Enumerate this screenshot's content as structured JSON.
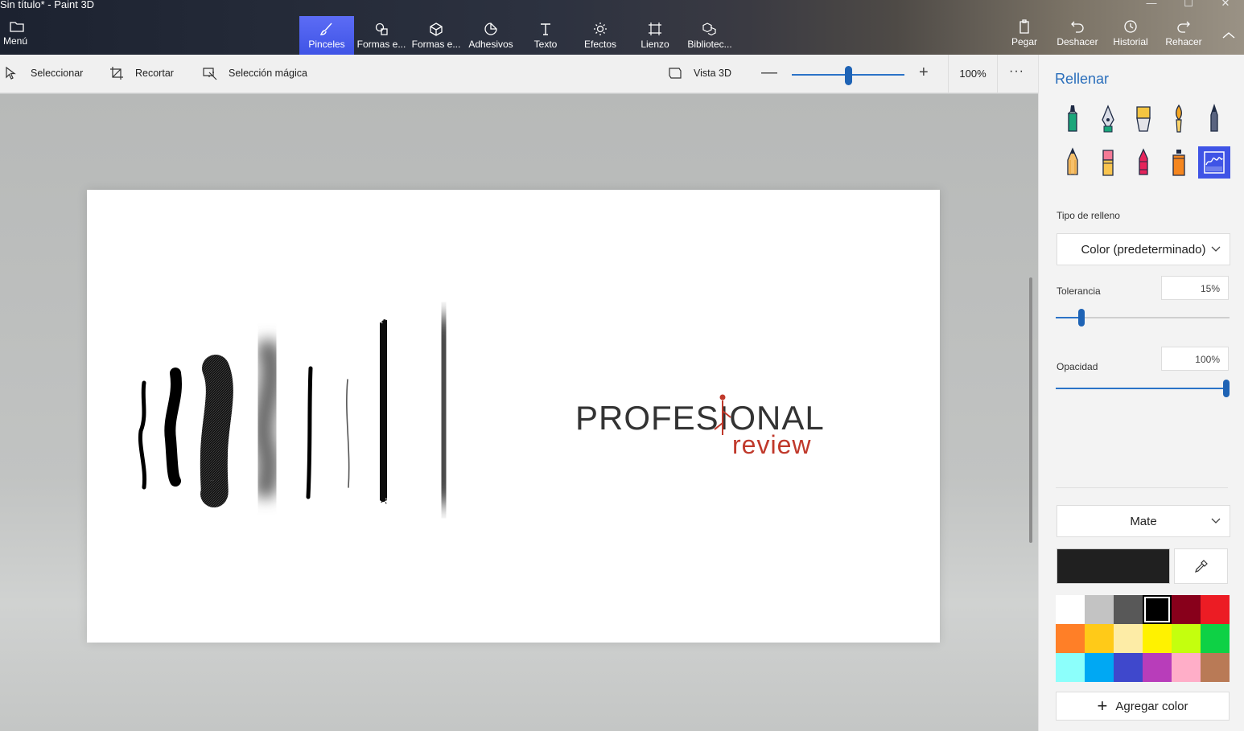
{
  "window": {
    "title": "Sin título* - Paint 3D",
    "controls": [
      "—",
      "☐",
      "✕"
    ]
  },
  "ribbon": {
    "menu_label": "Menú",
    "tools": [
      {
        "label": "Pinceles",
        "icon": "brush-icon"
      },
      {
        "label": "Formas e...",
        "icon": "2d-shapes-icon"
      },
      {
        "label": "Formas e...",
        "icon": "3d-shapes-icon"
      },
      {
        "label": "Adhesivos",
        "icon": "stickers-icon"
      },
      {
        "label": "Texto",
        "icon": "text-icon"
      },
      {
        "label": "Efectos",
        "icon": "effects-icon"
      },
      {
        "label": "Lienzo",
        "icon": "canvas-icon"
      },
      {
        "label": "Bibliotec...",
        "icon": "library-icon"
      }
    ],
    "active_tool": "Pinceles",
    "right_tools": [
      {
        "label": "Pegar",
        "icon": "paste-icon"
      },
      {
        "label": "Deshacer",
        "icon": "undo-icon"
      },
      {
        "label": "Historial",
        "icon": "history-icon"
      },
      {
        "label": "Rehacer",
        "icon": "redo-icon"
      }
    ]
  },
  "toolbar": {
    "select_label": "Seleccionar",
    "crop_label": "Recortar",
    "magic_select_label": "Selección mágica",
    "view3d_label": "Vista 3D",
    "zoom_level": "100%",
    "zoom_fraction": 0.5,
    "more": "···"
  },
  "canvas": {
    "logo_top": "PROFESIONAL",
    "logo_bottom": "review",
    "logo_colors": {
      "text": "#333333",
      "accent": "#c0392b"
    }
  },
  "panel": {
    "title": "Rellenar",
    "brushes": [
      "marker-icon",
      "calligraphy-pen-icon",
      "oil-brush-icon",
      "watercolor-icon",
      "pixel-pen-icon",
      "pencil-icon",
      "eraser-icon",
      "crayon-icon",
      "spray-can-icon",
      "fill-icon"
    ],
    "active_brush": "fill-icon",
    "fill_type_label": "Tipo de relleno",
    "fill_type_value": "Color (predeterminado)",
    "tolerance_label": "Tolerancia",
    "tolerance_value": "15%",
    "tolerance_fraction": 0.15,
    "opacity_label": "Opacidad",
    "opacity_value": "100%",
    "opacity_fraction": 1.0,
    "finish_value": "Mate",
    "current_color": "#202020",
    "palette": [
      "#ffffff",
      "#c3c3c3",
      "#585858",
      "#000000",
      "#88001b",
      "#ec1c24",
      "#ff7f27",
      "#ffca18",
      "#fdeca6",
      "#fff200",
      "#c4ff0e",
      "#0ed145",
      "#8cfffb",
      "#00a8f3",
      "#3f48cc",
      "#b83dba",
      "#ffaec8",
      "#b97a56"
    ],
    "selected_swatch": 3,
    "add_color_label": "Agregar color"
  }
}
